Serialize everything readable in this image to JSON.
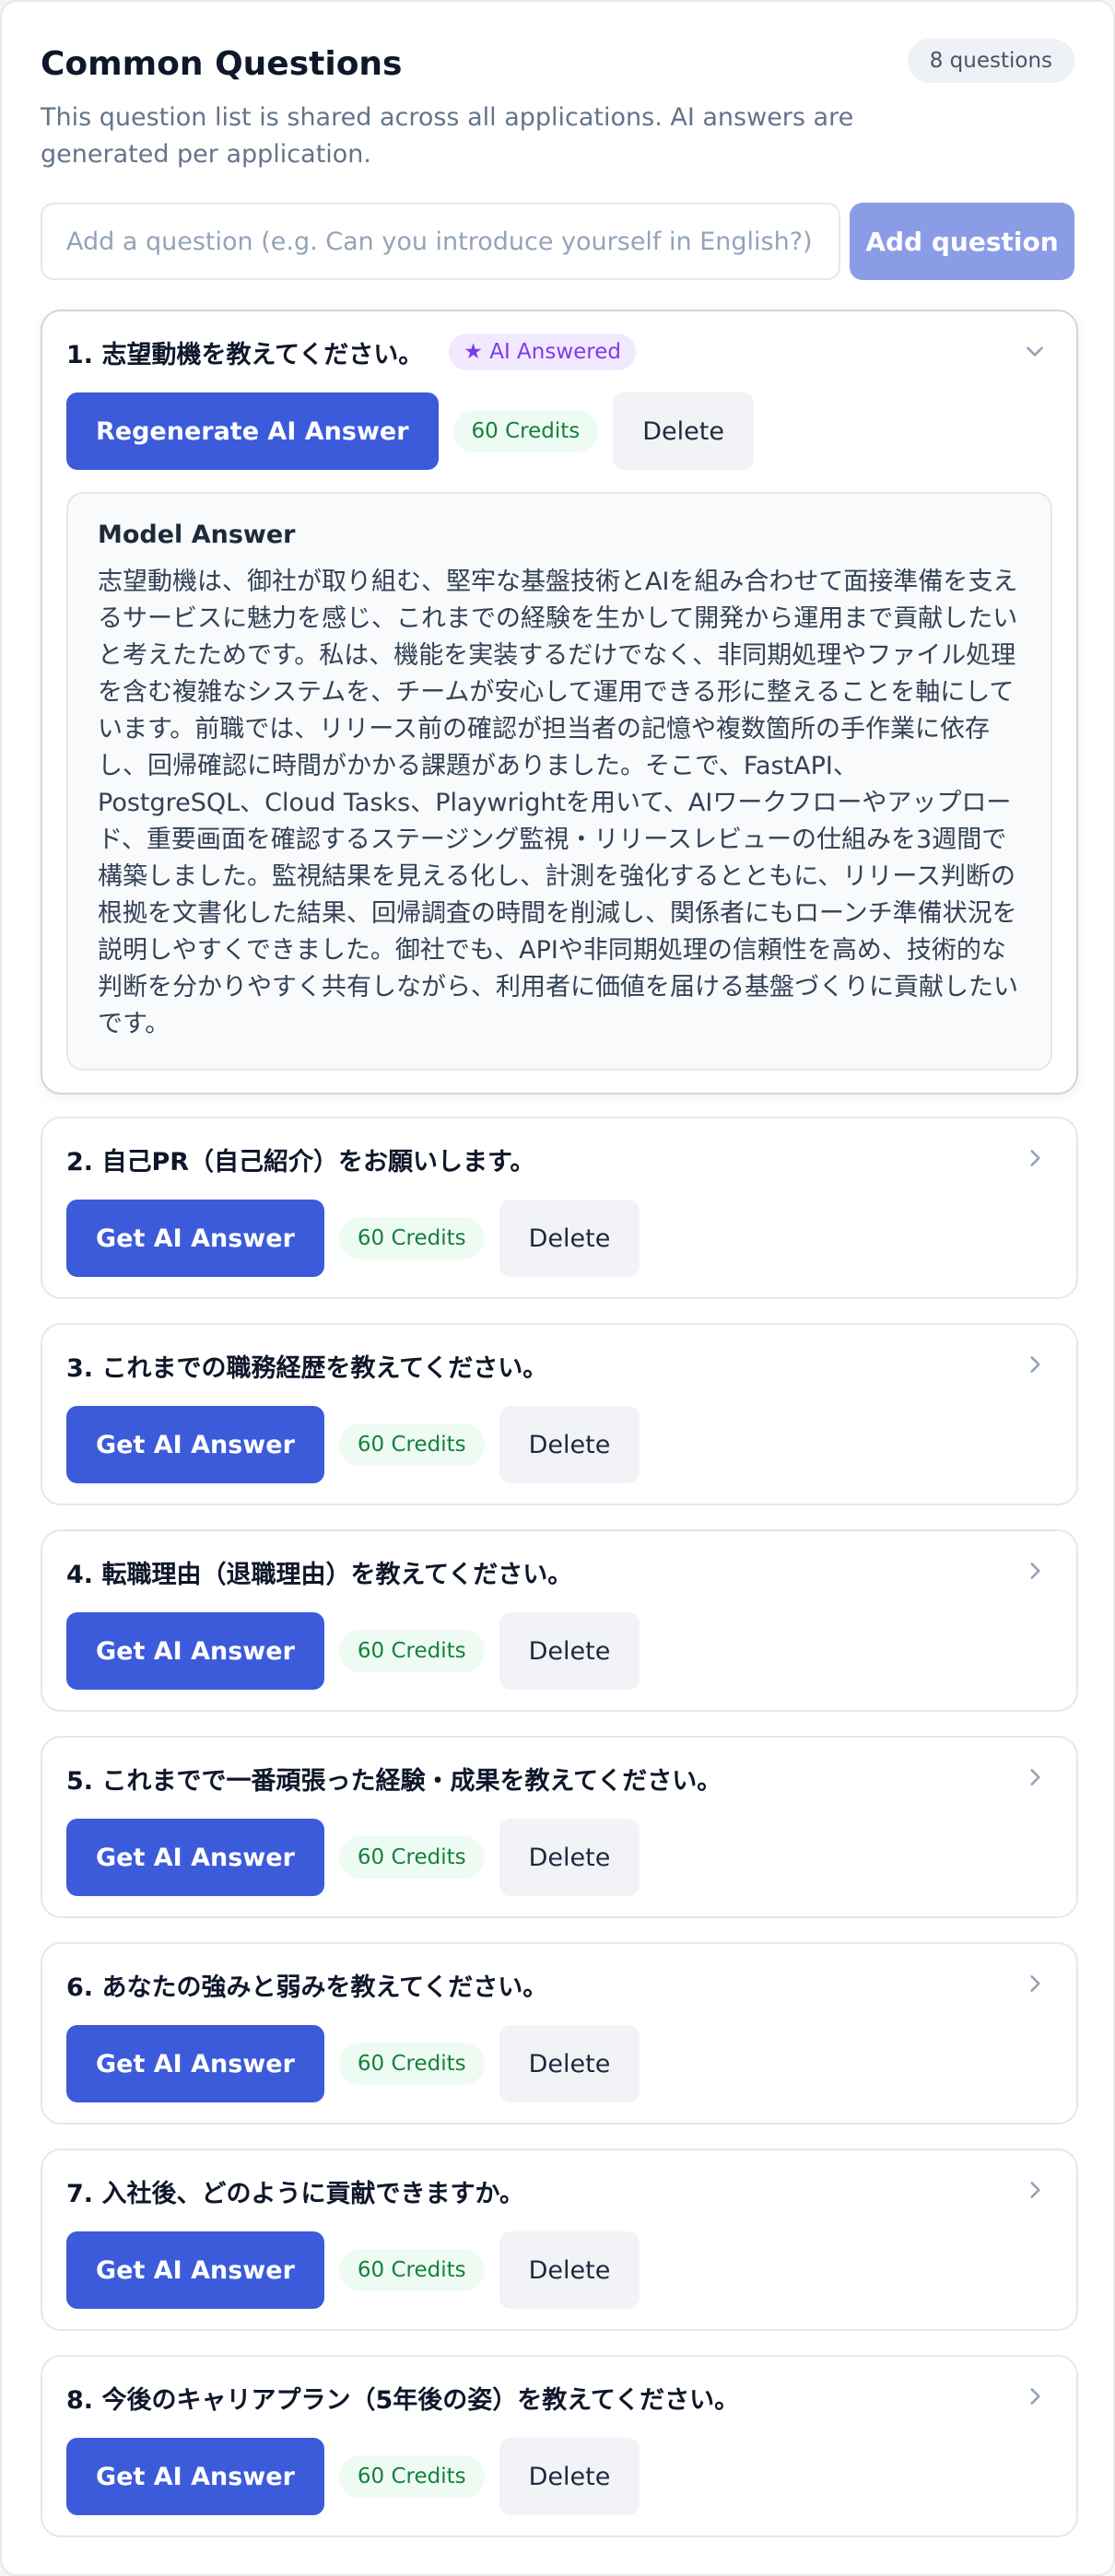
{
  "header": {
    "title": "Common Questions",
    "count_label": "8 questions",
    "subtitle": "This question list is shared across all applications. AI answers are generated per application."
  },
  "add_question": {
    "placeholder": "Add a question (e.g. Can you introduce yourself in English?)",
    "value": "",
    "button_label": "Add question"
  },
  "colors": {
    "primary": "#3b5bdb",
    "primary_disabled": "#8b9ce6",
    "credit_text": "#15803d",
    "ai_badge_text": "#7c3aed"
  },
  "questions": [
    {
      "text": "1. 志望動機を教えてください。",
      "expanded": true,
      "ai_badge": "★ AI Answered",
      "action_label": "Regenerate AI Answer",
      "credits": "60 Credits",
      "delete_label": "Delete",
      "answer_title": "Model Answer",
      "answer_text": "志望動機は、御社が取り組む、堅牢な基盤技術とAIを組み合わせて面接準備を支えるサービスに魅力を感じ、これまでの経験を生かして開発から運用まで貢献したいと考えたためです。私は、機能を実装するだけでなく、非同期処理やファイル処理を含む複雑なシステムを、チームが安心して運用できる形に整えることを軸にしています。前職では、リリース前の確認が担当者の記憶や複数箇所の手作業に依存し、回帰確認に時間がかかる課題がありました。そこで、FastAPI、PostgreSQL、Cloud Tasks、Playwrightを用いて、AIワークフローやアップロード、重要画面を確認するステージング監視・リリースレビューの仕組みを3週間で構築しました。監視結果を見える化し、計測を強化するとともに、リリース判断の根拠を文書化した結果、回帰調査の時間を削減し、関係者にもローンチ準備状況を説明しやすくできました。御社でも、APIや非同期処理の信頼性を高め、技術的な判断を分かりやすく共有しながら、利用者に価値を届ける基盤づくりに貢献したいです。"
    },
    {
      "text": "2. 自己PR（自己紹介）をお願いします。",
      "action_label": "Get AI Answer",
      "credits": "60 Credits",
      "delete_label": "Delete"
    },
    {
      "text": "3. これまでの職務経歴を教えてください。",
      "action_label": "Get AI Answer",
      "credits": "60 Credits",
      "delete_label": "Delete"
    },
    {
      "text": "4. 転職理由（退職理由）を教えてください。",
      "action_label": "Get AI Answer",
      "credits": "60 Credits",
      "delete_label": "Delete"
    },
    {
      "text": "5. これまでで一番頑張った経験・成果を教えてください。",
      "action_label": "Get AI Answer",
      "credits": "60 Credits",
      "delete_label": "Delete"
    },
    {
      "text": "6. あなたの強みと弱みを教えてください。",
      "action_label": "Get AI Answer",
      "credits": "60 Credits",
      "delete_label": "Delete"
    },
    {
      "text": "7. 入社後、どのように貢献できますか。",
      "action_label": "Get AI Answer",
      "credits": "60 Credits",
      "delete_label": "Delete"
    },
    {
      "text": "8. 今後のキャリアプラン（5年後の姿）を教えてください。",
      "action_label": "Get AI Answer",
      "credits": "60 Credits",
      "delete_label": "Delete"
    }
  ]
}
